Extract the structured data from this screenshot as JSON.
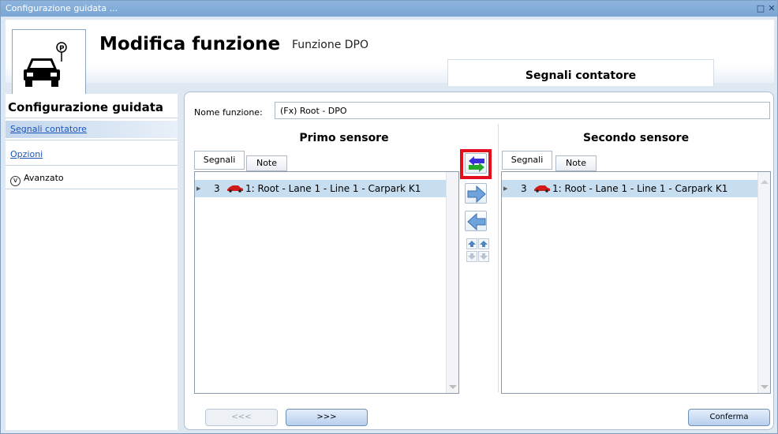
{
  "window": {
    "title": "Configurazione guidata ...",
    "controls": [
      "□",
      "✕"
    ]
  },
  "header": {
    "title": "Modifica funzione",
    "subtitle": "Funzione DPO",
    "step_tab": "Segnali contatore"
  },
  "sidebar": {
    "heading": "Configurazione guidata",
    "items": [
      {
        "label": "Segnali contatore",
        "selected": true
      },
      {
        "label": "Opzioni",
        "selected": false
      },
      {
        "label": "Avanzato",
        "icon": "chevron-down-circle-icon"
      }
    ]
  },
  "form": {
    "name_label": "Nome funzione:",
    "name_value": "(Fx) Root - DPO"
  },
  "primary": {
    "title": "Primo sensore",
    "tabs": [
      "Segnali",
      "Note"
    ],
    "rows": [
      {
        "num": "3",
        "text": "1: Root - Lane 1 - Line 1 - Carpark K1"
      }
    ]
  },
  "secondary": {
    "title": "Secondo sensore",
    "tabs": [
      "Segnali",
      "Note"
    ],
    "rows": [
      {
        "num": "3",
        "text": "1: Root - Lane 1 - Line 1 - Carpark K1"
      }
    ]
  },
  "footer": {
    "back_label": "<<<",
    "next_label": ">>>",
    "confirm_label": "Conferma"
  },
  "colors": {
    "selection": "#c7def1",
    "highlight": "#e3101c",
    "link": "#1a56b8"
  }
}
